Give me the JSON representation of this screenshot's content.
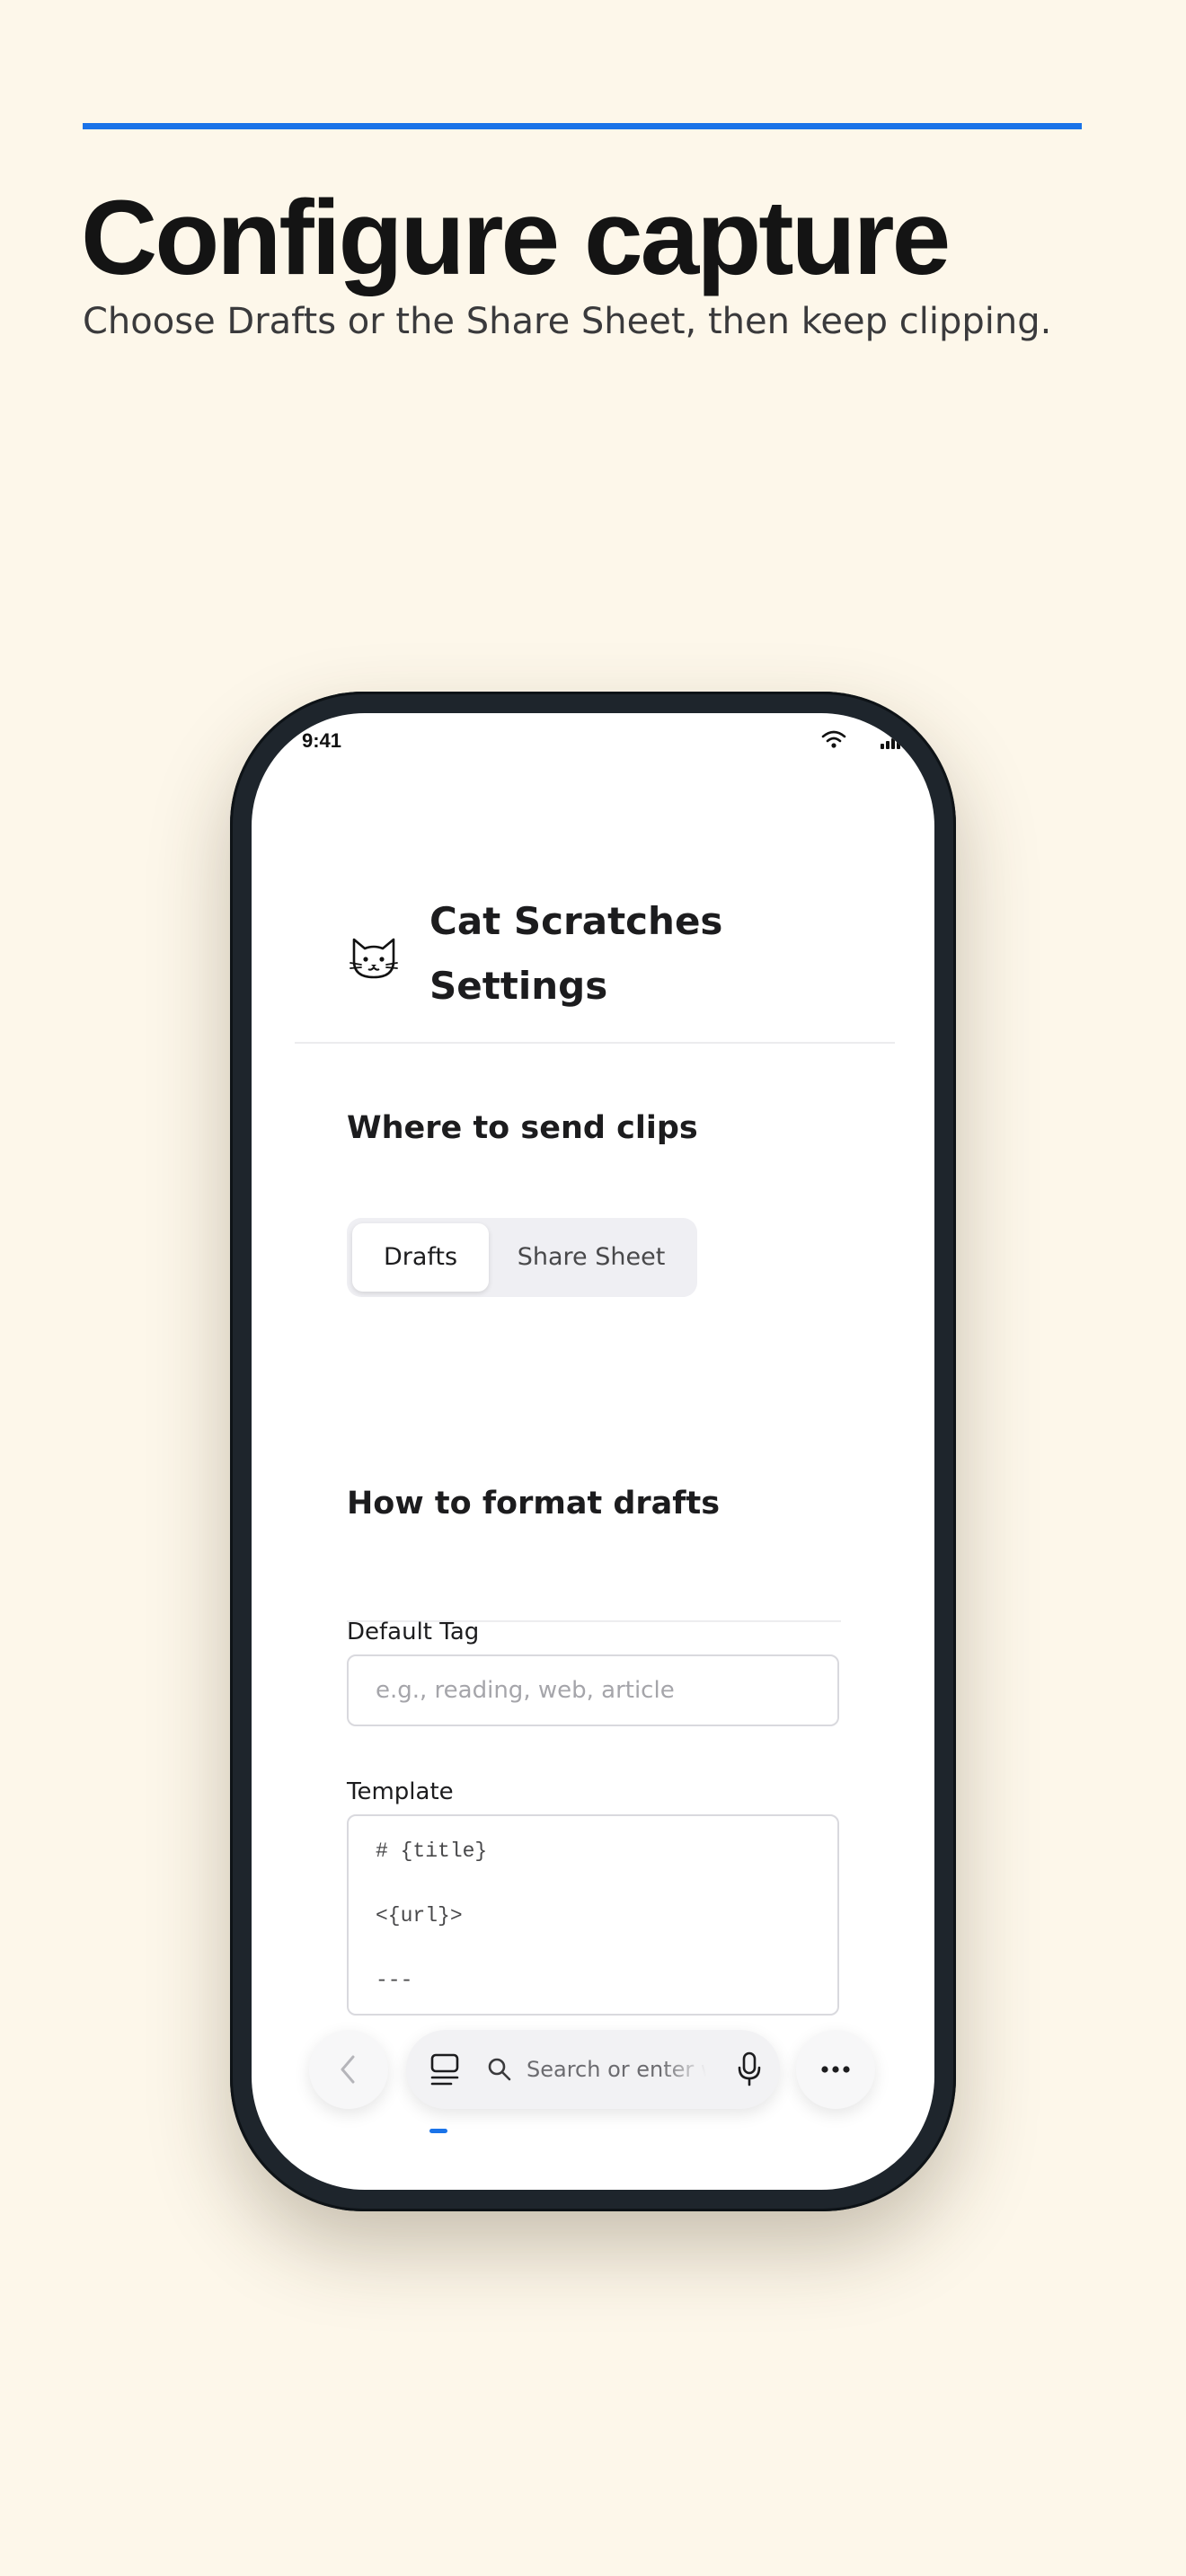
{
  "promo": {
    "title": "Configure capture",
    "subtitle": "Choose Drafts or the Share Sheet, then keep clipping.",
    "accent_color": "#1A73E8",
    "background_color": "#FDF7EA"
  },
  "status_bar": {
    "time": "9:41",
    "icons": [
      "wifi-icon",
      "cellular-signal-icon"
    ]
  },
  "app": {
    "icon": "cat-face-icon",
    "title": "Cat Scratches Settings"
  },
  "destination": {
    "heading": "Where to send clips",
    "options": [
      "Drafts",
      "Share Sheet"
    ],
    "selected": "Drafts"
  },
  "format": {
    "heading": "How to format drafts",
    "default_tag": {
      "label": "Default Tag",
      "value": "",
      "placeholder": "e.g., reading, web, article"
    },
    "template": {
      "label": "Template",
      "lines": [
        "# {title}",
        "<{url}>",
        "---"
      ]
    }
  },
  "browser_toolbar": {
    "back_icon": "chevron-left-icon",
    "tabs_icon": "tabs-icon",
    "search_icon": "search-icon",
    "address_placeholder": "Search or enter website name",
    "mic_icon": "microphone-icon",
    "more_icon": "more-icon"
  }
}
